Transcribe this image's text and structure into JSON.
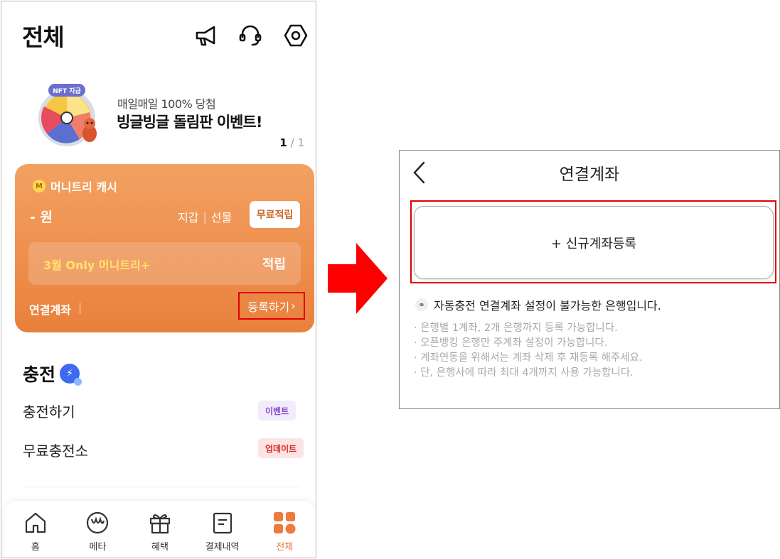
{
  "left": {
    "title": "전체",
    "header_icons": [
      "megaphone-icon",
      "headset-icon",
      "settings-icon"
    ],
    "banner": {
      "badge": "NFT 지급",
      "subtitle": "매일매일 100% 당첨",
      "title": "빙글빙글 돌림판 이벤트!",
      "page_current": "1",
      "page_total": "/ 1"
    },
    "cash_card": {
      "coin_glyph": "M",
      "label": "머니트리 캐시",
      "amount": "- 원",
      "wallet": "지갑",
      "gift": "선물",
      "free_button": "무료적립",
      "promo_text": "3월 Only 머니트리+",
      "promo_action": "적립",
      "linked_account": "연결계좌",
      "register": "등록하기"
    },
    "charge": {
      "title": "충전",
      "items": [
        {
          "label": "충전하기",
          "tag": "이벤트"
        },
        {
          "label": "무료충전소",
          "tag": "업데이트"
        }
      ]
    },
    "tabbar": [
      {
        "label": "홈",
        "icon": "home-icon"
      },
      {
        "label": "메타",
        "icon": "meta-icon"
      },
      {
        "label": "혜택",
        "icon": "gift-icon"
      },
      {
        "label": "결제내역",
        "icon": "receipt-icon"
      },
      {
        "label": "전체",
        "icon": "grid-icon",
        "active": true
      }
    ]
  },
  "right": {
    "title": "연결계좌",
    "add_button": "+ 신규계좌등록",
    "notice": "자동충전 연결계좌 설정이 불가능한 은행입니다.",
    "bullets": [
      "은행별 1계좌, 2개 은행까지 등록 가능합니다.",
      "오픈뱅킹 은행만 주계좌 설정이 가능합니다.",
      "계좌연동을 위해서는 계좌 삭제 후 재등록 해주세요.",
      "단, 은행사에 따라 최대 4개까지 사용 가능합니다."
    ]
  },
  "colors": {
    "card_orange": "#ee8c4b",
    "highlight_red": "#e00000",
    "arrow_red": "#ff0000",
    "active_tab": "#e57a39"
  }
}
